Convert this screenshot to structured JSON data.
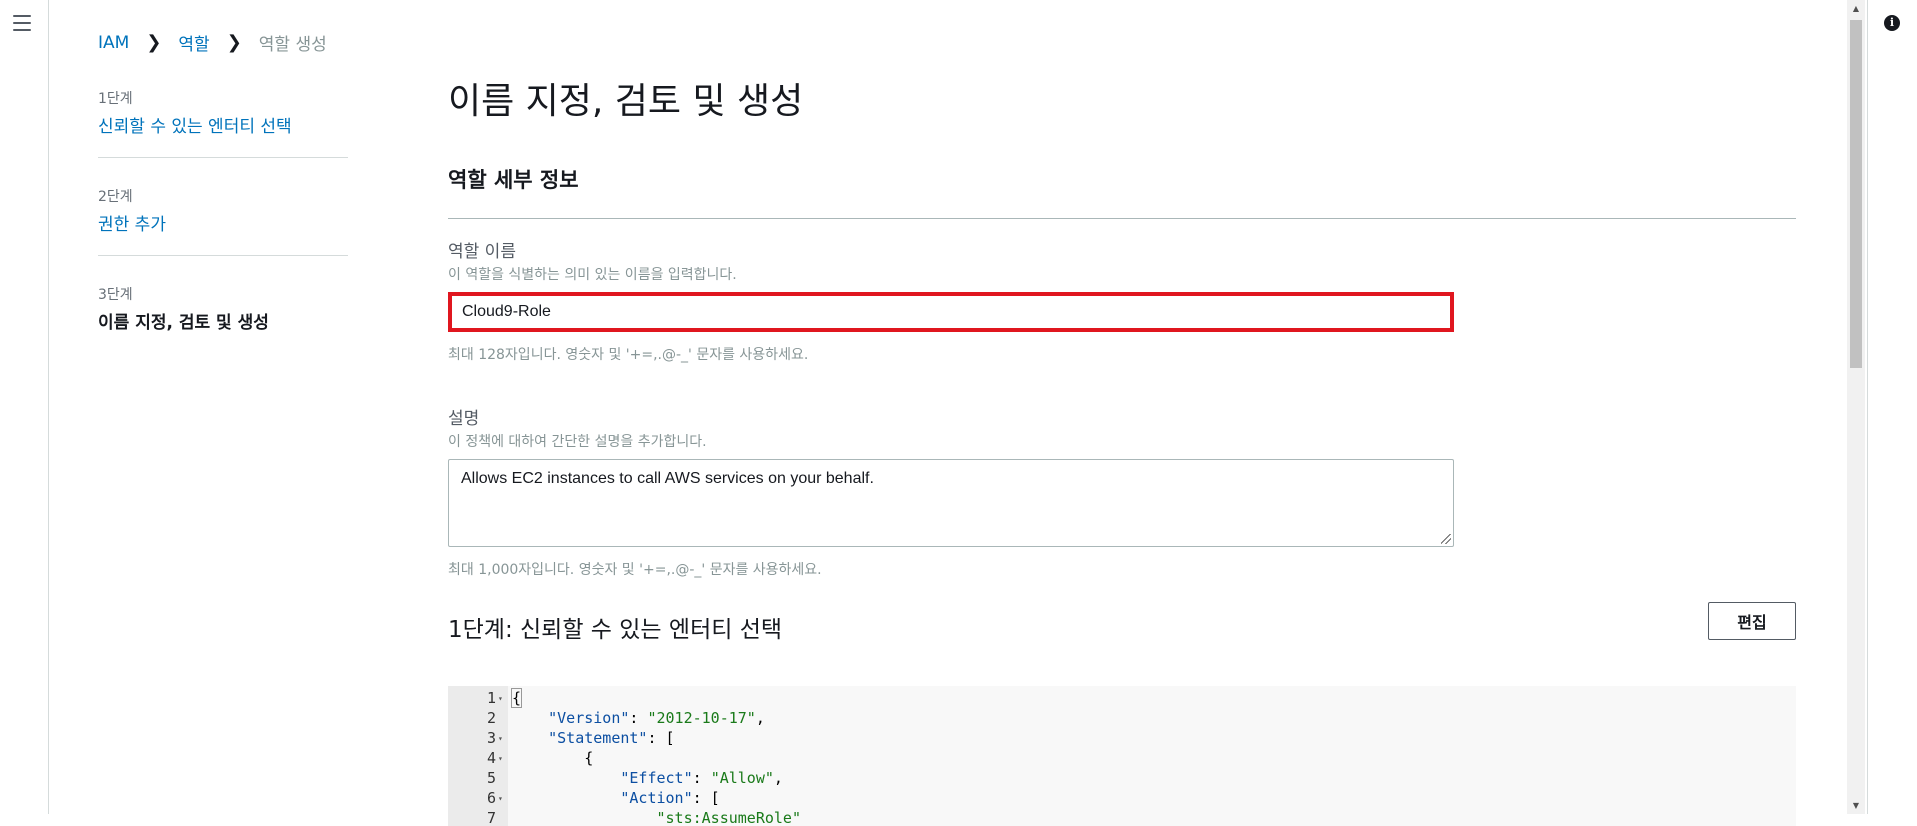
{
  "breadcrumb": {
    "root": "IAM",
    "section": "역할",
    "current": "역할 생성"
  },
  "steps": [
    {
      "number": "1단계",
      "label": "신뢰할 수 있는 엔터티 선택"
    },
    {
      "number": "2단계",
      "label": "권한 추가"
    },
    {
      "number": "3단계",
      "label": "이름 지정, 검토 및 생성"
    }
  ],
  "page_title": "이름 지정, 검토 및 생성",
  "role_details": {
    "section_title": "역할 세부 정보",
    "role_name": {
      "label": "역할 이름",
      "description": "이 역할을 식별하는 의미 있는 이름을 입력합니다.",
      "value": "Cloud9-Role",
      "hint": "최대 128자입니다. 영숫자 및 '+=,.@-_' 문자를 사용하세요."
    },
    "description": {
      "label": "설명",
      "description": "이 정책에 대하여 간단한 설명을 추가합니다.",
      "value": "Allows EC2 instances to call AWS services on your behalf.",
      "hint": "최대 1,000자입니다. 영숫자 및 '+=,.@-_' 문자를 사용하세요."
    }
  },
  "trust_section": {
    "title": "1단계: 신뢰할 수 있는 엔터티 선택",
    "edit_label": "편집"
  },
  "code_lines": [
    {
      "n": "1",
      "fold": true,
      "text": "{"
    },
    {
      "n": "2",
      "fold": false,
      "text": "    \"Version\": \"2012-10-17\","
    },
    {
      "n": "3",
      "fold": true,
      "text": "    \"Statement\": ["
    },
    {
      "n": "4",
      "fold": true,
      "text": "        {"
    },
    {
      "n": "5",
      "fold": false,
      "text": "            \"Effect\": \"Allow\","
    },
    {
      "n": "6",
      "fold": true,
      "text": "            \"Action\": ["
    },
    {
      "n": "7",
      "fold": false,
      "text": "                \"sts:AssumeRole\""
    }
  ],
  "icons": {
    "menu": "hamburger-menu-icon",
    "info": "info-icon",
    "breadcrumb_separator": "chevron-right-icon"
  },
  "colors": {
    "link": "#0073bb",
    "highlight_border": "#e0161f",
    "json_key": "#0c4fa2",
    "json_string": "#1a7a1a"
  }
}
